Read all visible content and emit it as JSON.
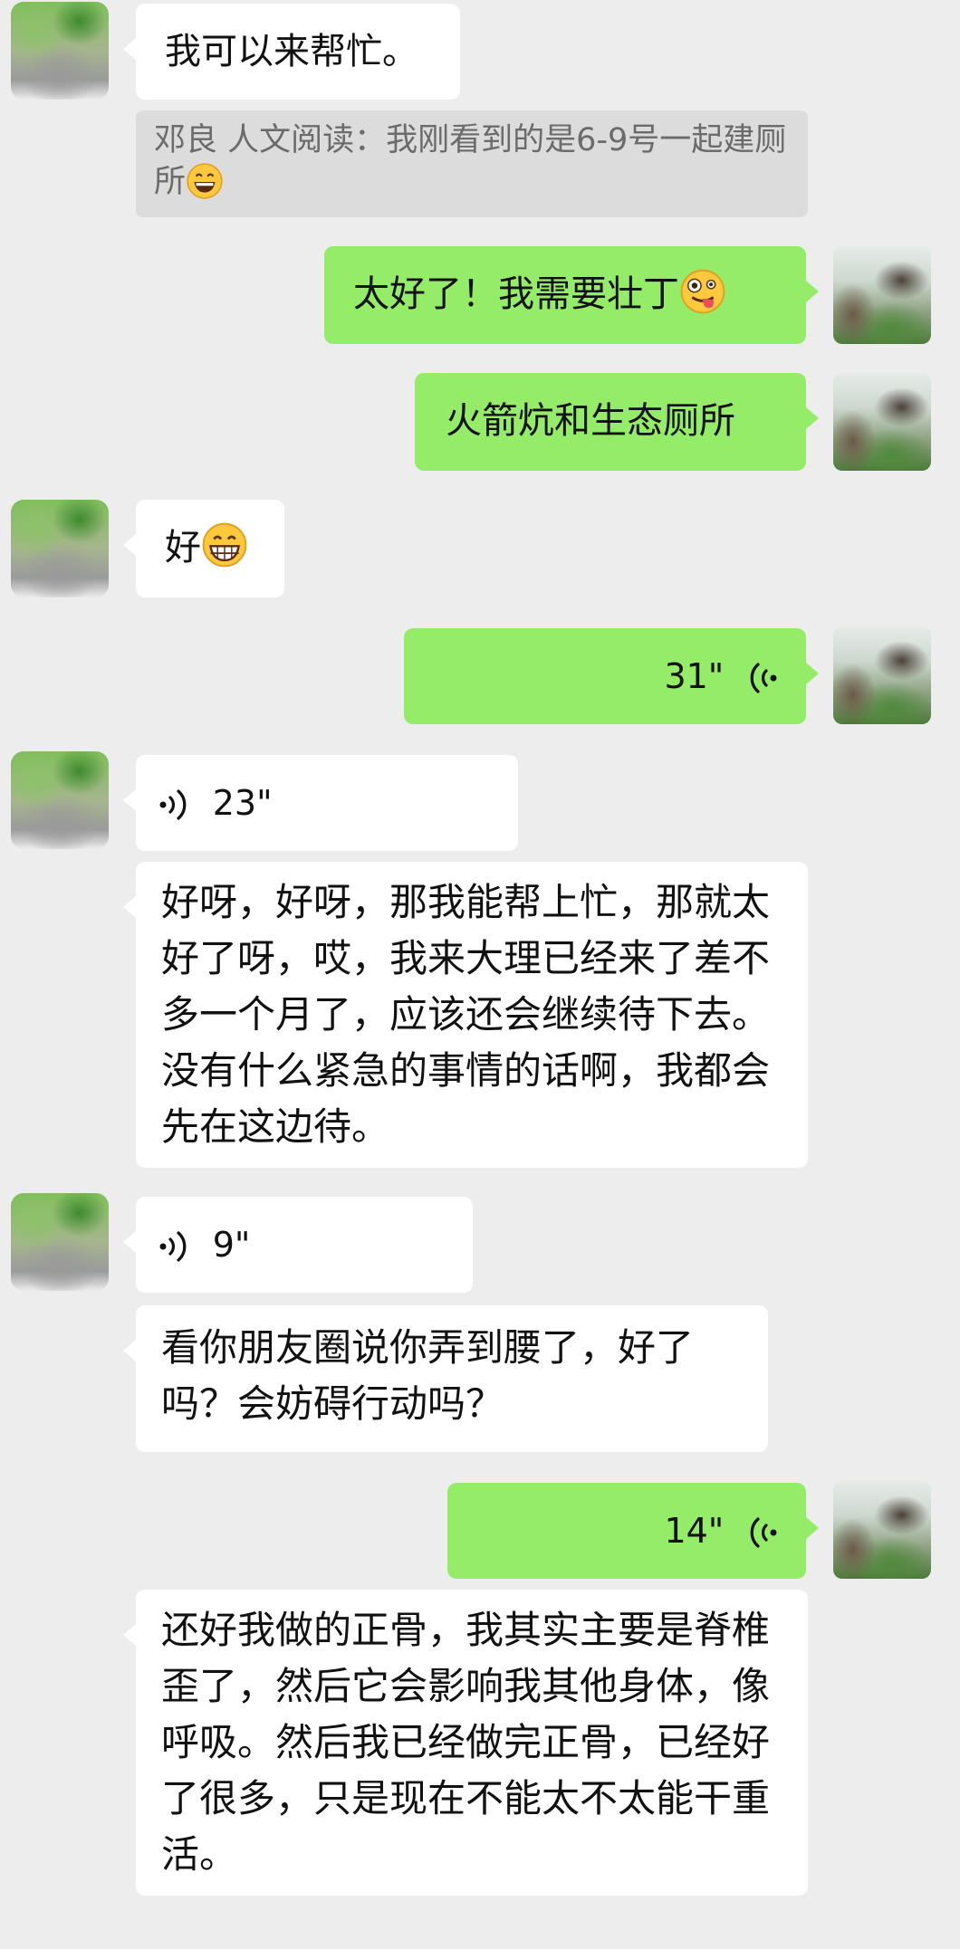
{
  "messages": [
    {
      "id": "m1",
      "from": "other",
      "type": "text",
      "text": "我可以来帮忙。"
    },
    {
      "id": "m2",
      "from": "other",
      "type": "quote",
      "text": "邓良  人文阅读：我刚看到的是6-9号一起建厕所",
      "emoji": "grinning-face-emoji"
    },
    {
      "id": "m3",
      "from": "self",
      "type": "text",
      "text": "太好了！我需要壮丁",
      "emoji": "zany-face-emoji"
    },
    {
      "id": "m4",
      "from": "self",
      "type": "text",
      "text": "火箭炕和生态厕所"
    },
    {
      "id": "m5",
      "from": "other",
      "type": "text",
      "text": "好",
      "emoji": "grinning-face-emoji"
    },
    {
      "id": "m6",
      "from": "self",
      "type": "voice",
      "duration": "31\""
    },
    {
      "id": "m7",
      "from": "other",
      "type": "voice",
      "duration": "23\""
    },
    {
      "id": "m8",
      "from": "other",
      "type": "text",
      "text": "好呀，好呀，那我能帮上忙，那就太好了呀，哎，我来大理已经来了差不多一个月了，应该还会继续待下去。没有什么紧急的事情的话啊，我都会先在这边待。"
    },
    {
      "id": "m9",
      "from": "other",
      "type": "voice",
      "duration": "9\""
    },
    {
      "id": "m10",
      "from": "other",
      "type": "text",
      "text": "看你朋友圈说你弄到腰了，好了吗？会妨碍行动吗？"
    },
    {
      "id": "m11",
      "from": "self",
      "type": "voice",
      "duration": "14\""
    },
    {
      "id": "m12",
      "from": "other",
      "type": "text",
      "text": "还好我做的正骨，我其实主要是脊椎歪了，然后它会影响我其他身体，像呼吸。然后我已经做完正骨，已经好了很多，只是现在不能太不太能干重活。"
    }
  ],
  "colors": {
    "background": "#ededed",
    "self_bubble": "#95ec69",
    "other_bubble": "#ffffff",
    "quote_bg": "#dcdcdc",
    "quote_text": "#6b6b6b"
  }
}
